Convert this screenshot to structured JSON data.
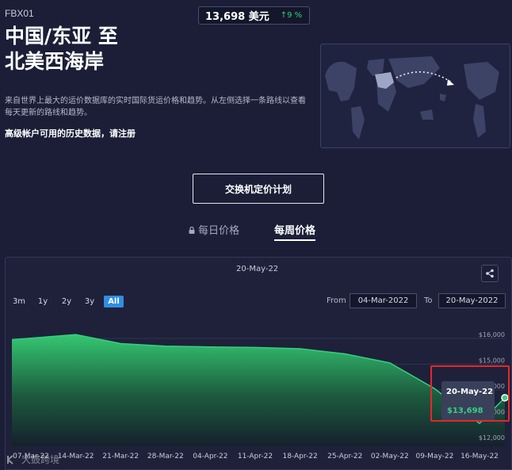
{
  "route_code": "FBX01",
  "price_chip": {
    "value": "13,698 美元",
    "change": "9 %",
    "change_arrow": "↑"
  },
  "title": {
    "line1": "中国/东亚 至",
    "line2": "北美西海岸"
  },
  "description": "来自世界上最大的运价数据库的实时国际货运价格和趋势。从左侧选择一条路线以查看每天更新的路线和趋势。",
  "history_note": "高级帐户可用的历史数据，请注册",
  "exchange_button": "交换机定价计划",
  "tabs": [
    {
      "label": "每日价格",
      "icon": "lock-icon",
      "active": false
    },
    {
      "label": "每周价格",
      "active": true
    }
  ],
  "panel": {
    "date": "20-May-22",
    "range_buttons": [
      "3m",
      "1y",
      "2y",
      "3y",
      "All"
    ],
    "active_range": "All",
    "from_label": "From",
    "from_value": "04-Mar-2022",
    "to_label": "To",
    "to_value": "20-May-2022"
  },
  "tooltip": {
    "date": "20-May-22",
    "value": "$13,698"
  },
  "watermark": "大鼓跨境",
  "colors": {
    "background": "#1b1e36",
    "accent_green": "#35d07f",
    "accent_blue": "#2f8de4",
    "highlight_red": "#e8262a"
  },
  "chart_data": {
    "type": "area",
    "x": [
      "07-Mar-22",
      "14-Mar-22",
      "21-Mar-22",
      "28-Mar-22",
      "04-Apr-22",
      "11-Apr-22",
      "18-Apr-22",
      "25-Apr-22",
      "02-May-22",
      "09-May-22",
      "16-May-22",
      "20-May-22"
    ],
    "x_tick_labels": [
      "07-Mar-22",
      "14-Mar-22",
      "21-Mar-22",
      "28-Mar-22",
      "04-Apr-22",
      "11-Apr-22",
      "18-Apr-22",
      "25-Apr-22",
      "02-May-22",
      "09-May-22",
      "16-May-22"
    ],
    "values": [
      15950,
      16150,
      15800,
      15700,
      15670,
      15650,
      15600,
      15400,
      15050,
      14050,
      12700,
      13698
    ],
    "y_ticks": [
      "$16,000",
      "$15,000",
      "$14,000",
      "$13,000",
      "$12,000"
    ],
    "y_tick_values": [
      16000,
      15000,
      14000,
      13000,
      12000
    ],
    "ylim": [
      12000,
      16000
    ],
    "grid": true,
    "series_color": "#35d07f"
  }
}
